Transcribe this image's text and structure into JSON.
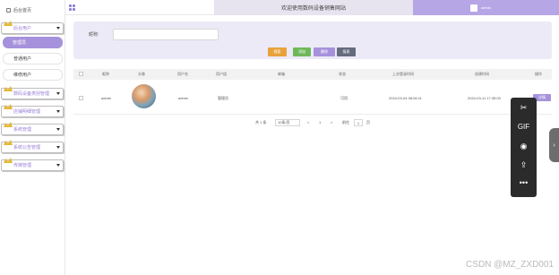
{
  "sidebar": {
    "home": "后台首页",
    "menus": [
      {
        "label": "后台用户",
        "sub": [
          "管理员",
          "普通用户",
          "维修用户"
        ]
      },
      {
        "label": "数码设备类别管理"
      },
      {
        "label": "店铺明细管理"
      },
      {
        "label": "系统管理"
      },
      {
        "label": "系统公告管理"
      },
      {
        "label": "传媒管理"
      }
    ]
  },
  "header": {
    "title": "欢迎使用数码设备销售网站",
    "username": "admin"
  },
  "search": {
    "label": "昵称:",
    "placeholder": "",
    "buttons": {
      "search": "搜索",
      "add": "添加",
      "delete": "删除",
      "report": "报表"
    }
  },
  "table": {
    "columns": [
      "昵称",
      "头像",
      "用户名",
      "用户组",
      "邮箱",
      "状态",
      "上次登录时间",
      "创建时间",
      "操作"
    ],
    "rows": [
      {
        "nickname": "admin",
        "username": "admin",
        "group": "管理员",
        "email": "",
        "status": "可用",
        "last_login": "2024-03-04 08:06:11",
        "created": "2024-03-11 17:35:00",
        "action": "详情"
      }
    ]
  },
  "pagination": {
    "total": "共 1 条",
    "page_size": "10条/页",
    "prev": "<",
    "current": "1",
    "next": ">",
    "goto_label": "前往",
    "goto_value": "1",
    "page_unit": "页"
  },
  "floating_toolbar": {
    "items": [
      "scissors-icon",
      "GIF",
      "record-icon",
      "share-icon",
      "•••"
    ]
  },
  "watermark": "CSDN @MZ_ZXD001",
  "colors": {
    "accent": "#a692dc",
    "search": "#e8a23c",
    "add": "#6fb85a",
    "report": "#646c7e"
  }
}
